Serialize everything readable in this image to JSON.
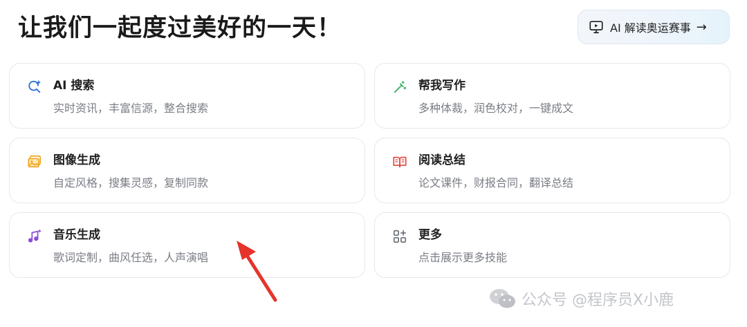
{
  "header": {
    "title": "让我们一起度过美好的一天！",
    "promo_button_label": "AI 解读奥运赛事",
    "promo_button_arrow": "→"
  },
  "cards": [
    {
      "title": "AI 搜索",
      "desc": "实时资讯，丰富信源，整合搜索",
      "icon": "ai-search-icon",
      "icon_color": "#2b6fd6"
    },
    {
      "title": "帮我写作",
      "desc": "多种体裁，润色校对，一键成文",
      "icon": "magic-pen-icon",
      "icon_color": "#3fae63"
    },
    {
      "title": "图像生成",
      "desc": "自定风格，搜集灵感，复制同款",
      "icon": "image-icon",
      "icon_color": "#f0a21b"
    },
    {
      "title": "阅读总结",
      "desc": "论文课件，财报合同，翻译总结",
      "icon": "open-book-icon",
      "icon_color": "#e0463c"
    },
    {
      "title": "音乐生成",
      "desc": "歌词定制，曲风任选，人声演唱",
      "icon": "music-note-icon",
      "icon_color": "#8a4fd6"
    },
    {
      "title": "更多",
      "desc": "点击展示更多技能",
      "icon": "grid-plus-icon",
      "icon_color": "#6b6f78"
    }
  ],
  "watermark": {
    "text": "公众号 @程序员X小鹿"
  },
  "colors": {
    "annotation_arrow": "#e5342b",
    "card_border": "#e6e8ee",
    "desc_text": "#7a7d85"
  }
}
